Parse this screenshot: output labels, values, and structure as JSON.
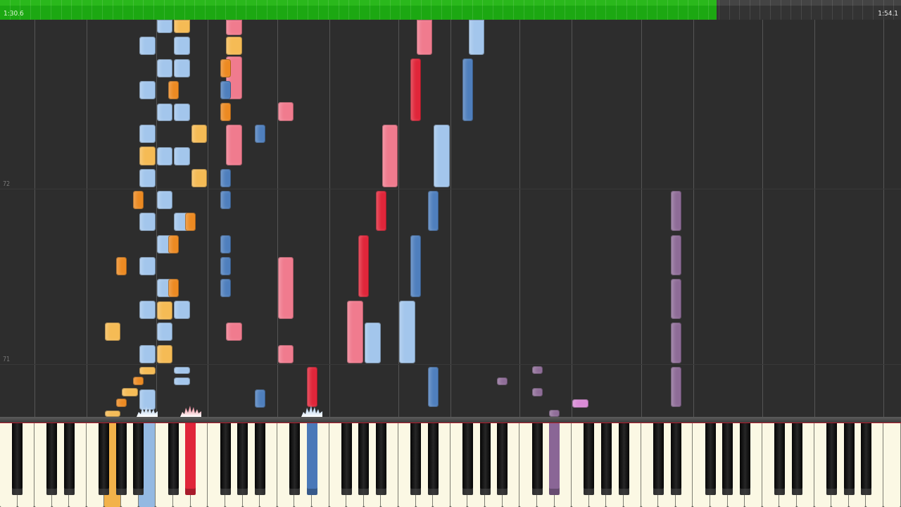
{
  "progress": {
    "elapsed": "1:30.6",
    "total": "1:54.1",
    "level": 0.795
  },
  "measure_numbers": [
    "72",
    "71"
  ],
  "tracks": [
    {
      "color": "#a3c6ec"
    },
    {
      "color": "#4f7fbd"
    },
    {
      "color": "#f5bb55"
    },
    {
      "color": "#ec8a22"
    },
    {
      "color": "#f07b8e"
    },
    {
      "color": "#e0263a"
    },
    {
      "color": "#8e6c97"
    },
    {
      "color": "#d98bd6"
    }
  ],
  "keyboard": {
    "white_keys": [
      {
        "pressed": false
      },
      {
        "pressed": false
      },
      {
        "pressed": false
      },
      {
        "pressed": false
      },
      {
        "pressed": false
      },
      {
        "pressed": false
      },
      {
        "pressed": true,
        "color": "#f2b24a"
      },
      {
        "pressed": false
      },
      {
        "pressed": true,
        "color": "#94b9e2"
      },
      {
        "pressed": false
      },
      {
        "pressed": false
      },
      {
        "pressed": false
      },
      {
        "pressed": false
      },
      {
        "pressed": false
      },
      {
        "pressed": false
      },
      {
        "pressed": false
      },
      {
        "pressed": false
      },
      {
        "pressed": false
      },
      {
        "pressed": false
      },
      {
        "pressed": false
      },
      {
        "pressed": false
      },
      {
        "pressed": false
      },
      {
        "pressed": false
      },
      {
        "pressed": false
      },
      {
        "pressed": false
      },
      {
        "pressed": false
      },
      {
        "pressed": false
      },
      {
        "pressed": false
      },
      {
        "pressed": false
      },
      {
        "pressed": false
      },
      {
        "pressed": false
      },
      {
        "pressed": false
      },
      {
        "pressed": false
      },
      {
        "pressed": false
      },
      {
        "pressed": false
      },
      {
        "pressed": false
      },
      {
        "pressed": false
      },
      {
        "pressed": false
      },
      {
        "pressed": false
      },
      {
        "pressed": false
      },
      {
        "pressed": false
      },
      {
        "pressed": false
      },
      {
        "pressed": false
      },
      {
        "pressed": false
      },
      {
        "pressed": false
      },
      {
        "pressed": false
      },
      {
        "pressed": false
      },
      {
        "pressed": false
      },
      {
        "pressed": false
      },
      {
        "pressed": false
      },
      {
        "pressed": false
      },
      {
        "pressed": false
      }
    ],
    "black_keys": [
      {
        "pressed": false
      },
      {
        "pressed": false
      },
      {
        "pressed": false
      },
      {
        "pressed": false
      },
      {
        "pressed": false
      },
      {
        "pressed": false
      },
      {
        "pressed": false
      },
      {
        "pressed": true,
        "color": "#e0263a"
      },
      {
        "pressed": false
      },
      {
        "pressed": false
      },
      {
        "pressed": false
      },
      {
        "pressed": false
      },
      {
        "pressed": true,
        "color": "#4a79b8"
      },
      {
        "pressed": false
      },
      {
        "pressed": false
      },
      {
        "pressed": false
      },
      {
        "pressed": false
      },
      {
        "pressed": false
      },
      {
        "pressed": false
      },
      {
        "pressed": false
      },
      {
        "pressed": false
      },
      {
        "pressed": false
      },
      {
        "pressed": true,
        "color": "#8a6696"
      },
      {
        "pressed": false
      },
      {
        "pressed": false
      },
      {
        "pressed": false
      },
      {
        "pressed": false
      },
      {
        "pressed": false
      },
      {
        "pressed": false
      },
      {
        "pressed": false
      },
      {
        "pressed": false
      },
      {
        "pressed": false
      },
      {
        "pressed": false
      },
      {
        "pressed": false
      },
      {
        "pressed": false
      },
      {
        "pressed": false
      }
    ]
  }
}
